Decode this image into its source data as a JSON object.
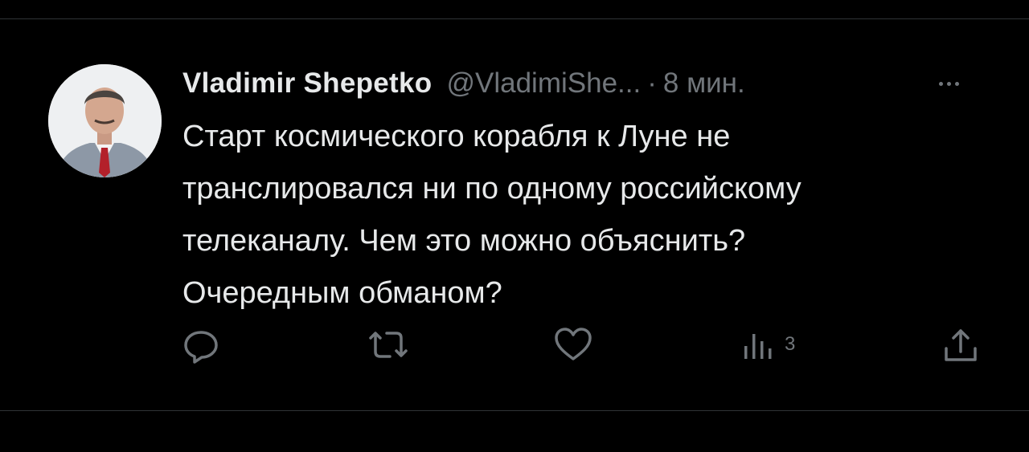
{
  "tweet": {
    "author_name": "Vladimir Shepetko",
    "author_handle": "@VladimiShe...",
    "separator": "·",
    "time": "8 мин.",
    "text_lines": [
      "Старт космического корабля к Луне не",
      "транслировался ни по одному российскому",
      "телеканалу. Чем это можно объяснить?",
      "Очередным обманом?"
    ],
    "stats": {
      "views": "3"
    }
  },
  "icons": {
    "reply": "reply-icon",
    "retweet": "retweet-icon",
    "like": "heart-icon",
    "views": "bar-chart-icon",
    "share": "share-icon",
    "more": "more-icon"
  },
  "colors": {
    "background": "#000000",
    "text": "#e7e9ea",
    "secondary": "#71767b",
    "divider": "#2f3336"
  }
}
